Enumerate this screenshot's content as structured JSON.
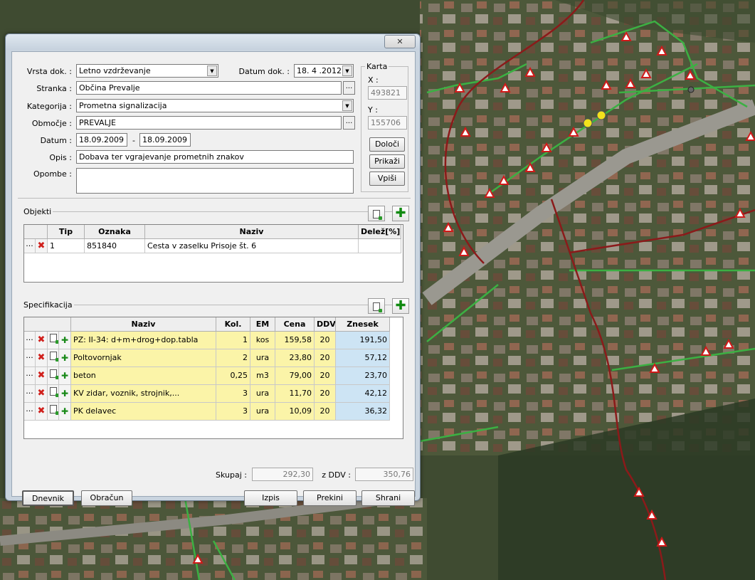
{
  "window": {
    "close_label": "✕"
  },
  "form": {
    "vrsta_label": "Vrsta dok. :",
    "vrsta_value": "Letno vzdrževanje",
    "datum_dok_label": "Datum dok. :",
    "datum_dok_value": "18. 4 .2012",
    "stranka_label": "Stranka :",
    "stranka_value": "Občina Prevalje",
    "kategorija_label": "Kategorija :",
    "kategorija_value": "Prometna signalizacija",
    "obmocje_label": "Območje :",
    "obmocje_value": "PREVALJE",
    "datum_label": "Datum :",
    "datum_from": "18.09.2009",
    "datum_sep": "-",
    "datum_to": "18.09.2009",
    "opis_label": "Opis :",
    "opis_value": "Dobava ter vgrajevanje prometnih znakov",
    "opombe_label": "Opombe :",
    "opombe_value": "",
    "ellipsis": "..."
  },
  "karta": {
    "title": "Karta",
    "x_label": "X :",
    "x_value": "493821",
    "y_label": "Y :",
    "y_value": "155706",
    "btn_doloci": "Določi",
    "btn_prikazi": "Prikaži",
    "btn_vpisi": "Vpiši"
  },
  "objekti": {
    "title": "Objekti",
    "headers": [
      "Tip",
      "Oznaka",
      "Naziv",
      "Delež[%]"
    ],
    "rows": [
      {
        "tip": "1",
        "oznaka": "851840",
        "naziv": "Cesta v zaselku Prisoje št. 6",
        "delez": ""
      }
    ]
  },
  "specifikacija": {
    "title": "Specifikacija",
    "headers": [
      "Naziv",
      "Kol.",
      "EM",
      "Cena",
      "DDV",
      "Znesek"
    ],
    "rows": [
      {
        "naziv": "PZ: II-34: d+m+drog+dop.tabla",
        "kol": "1",
        "em": "kos",
        "cena": "159,58",
        "ddv": "20",
        "znesek": "191,50"
      },
      {
        "naziv": "Poltovornjak",
        "kol": "2",
        "em": "ura",
        "cena": "23,80",
        "ddv": "20",
        "znesek": "57,12"
      },
      {
        "naziv": "beton",
        "kol": "0,25",
        "em": "m3",
        "cena": "79,00",
        "ddv": "20",
        "znesek": "23,70"
      },
      {
        "naziv": "KV zidar, voznik, strojnik,...",
        "kol": "3",
        "em": "ura",
        "cena": "11,70",
        "ddv": "20",
        "znesek": "42,12"
      },
      {
        "naziv": "PK delavec",
        "kol": "3",
        "em": "ura",
        "cena": "10,09",
        "ddv": "20",
        "znesek": "36,32"
      }
    ]
  },
  "totals": {
    "skupaj_label": "Skupaj :",
    "skupaj_value": "292,30",
    "zddv_label": "z DDV :",
    "zddv_value": "350,76"
  },
  "buttons": {
    "dnevnik": "Dnevnik",
    "obracun": "Obračun",
    "izpis": "Izpis",
    "prekini": "Prekini",
    "shrani": "Shrani"
  },
  "icons": {
    "row_menu": "···",
    "delete": "✖",
    "add": "✚"
  },
  "colors": {
    "row_highlight": "#fbf4a8",
    "amount_highlight": "#cde4f4",
    "map_line_green": "#3cb043",
    "map_line_red": "#8b1a1a"
  }
}
